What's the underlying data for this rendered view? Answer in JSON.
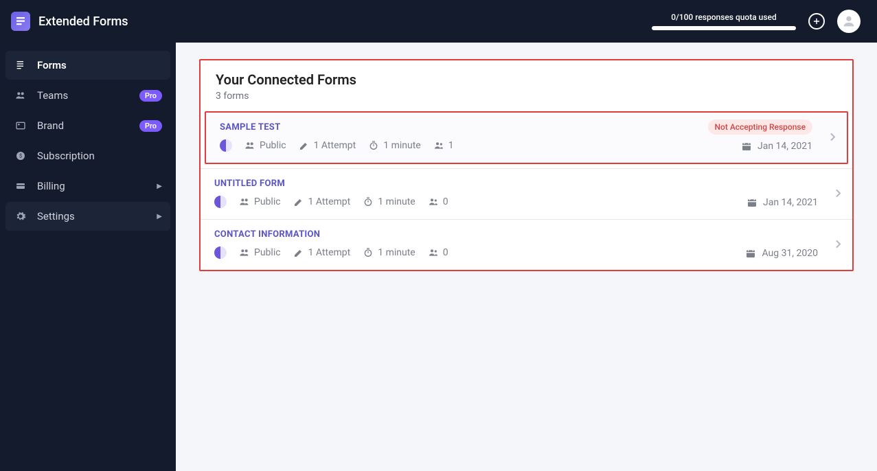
{
  "brand": {
    "name": "Extended Forms"
  },
  "sidebar": {
    "items": [
      {
        "label": "Forms"
      },
      {
        "label": "Teams",
        "badge": "Pro"
      },
      {
        "label": "Brand",
        "badge": "Pro"
      },
      {
        "label": "Subscription"
      },
      {
        "label": "Billing"
      },
      {
        "label": "Settings"
      }
    ]
  },
  "topbar": {
    "quota": "0/100 responses quota used"
  },
  "panel": {
    "title": "Your Connected Forms",
    "subtitle": "3 forms"
  },
  "forms": [
    {
      "title": "SAMPLE TEST",
      "visibility": "Public",
      "attempts": "1 Attempt",
      "duration": "1 minute",
      "responses": "1",
      "status": "Not Accepting Response",
      "date": "Jan 14, 2021"
    },
    {
      "title": "UNTITLED FORM",
      "visibility": "Public",
      "attempts": "1 Attempt",
      "duration": "1 minute",
      "responses": "0",
      "status": "",
      "date": "Jan 14, 2021"
    },
    {
      "title": "CONTACT INFORMATION",
      "visibility": "Public",
      "attempts": "1 Attempt",
      "duration": "1 minute",
      "responses": "0",
      "status": "",
      "date": "Aug 31, 2020"
    }
  ]
}
